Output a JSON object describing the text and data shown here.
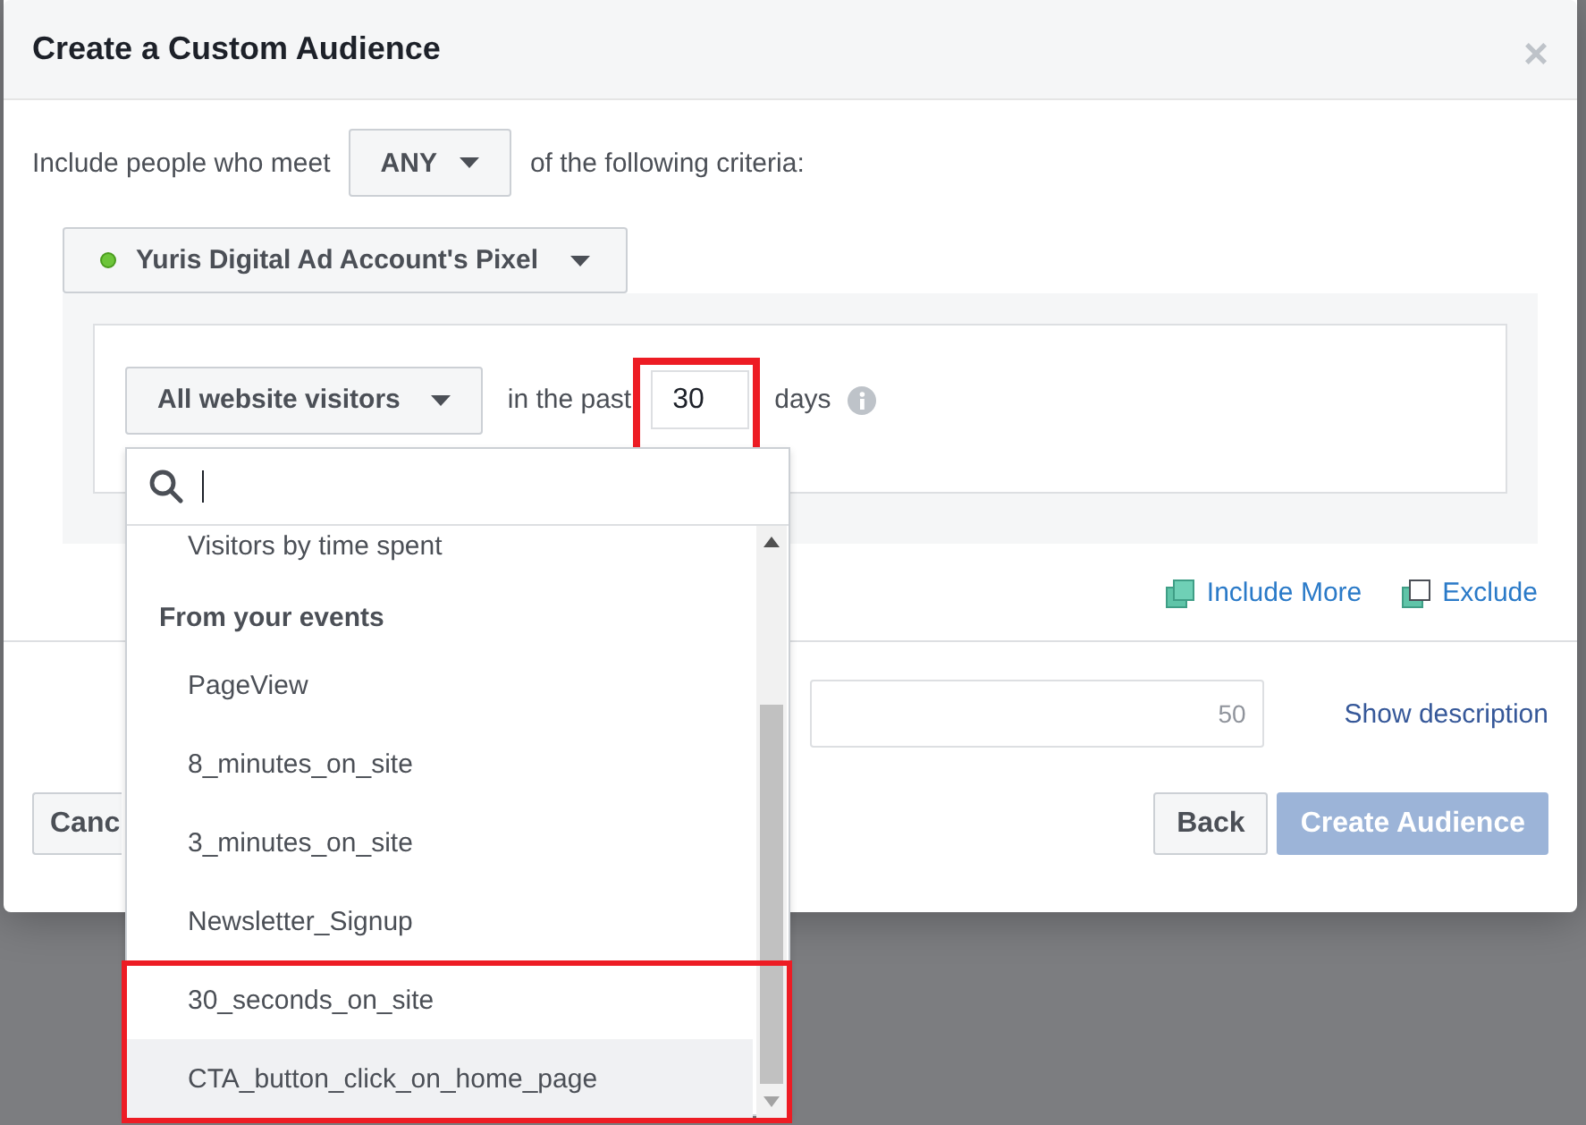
{
  "dialog": {
    "title": "Create a Custom Audience",
    "close_label": "×"
  },
  "criteria": {
    "prefix": "Include people who meet",
    "match": "ANY",
    "suffix": "of the following criteria:"
  },
  "pixel": {
    "name": "Yuris Digital Ad Account's Pixel",
    "active": true
  },
  "rule": {
    "audience": "All website visitors",
    "in_the_past": "in the past",
    "days": {
      "value": "30",
      "outlined": true
    },
    "days_label": "days"
  },
  "links": [
    {
      "label": "Include More",
      "kind": "include"
    },
    {
      "label": "Exclude",
      "kind": "exclude"
    }
  ],
  "name_field": {
    "counter": "50"
  },
  "show_description": "Show description",
  "buttons": [
    {
      "label": "Canc",
      "kind": "secondary",
      "disabled": false
    },
    {
      "label": "Back",
      "kind": "secondary",
      "disabled": false
    },
    {
      "label": "Create Audience",
      "kind": "primary",
      "disabled": true
    }
  ],
  "dropdown": {
    "items": [
      {
        "label": "Visitors by time spent",
        "kind": "option",
        "hovered": false,
        "outlined": false
      },
      {
        "label": "From your events",
        "kind": "header",
        "outlined": false
      },
      {
        "label": "PageView",
        "kind": "option",
        "hovered": false,
        "outlined": false
      },
      {
        "label": "8_minutes_on_site",
        "kind": "option",
        "hovered": false,
        "outlined": false
      },
      {
        "label": "3_minutes_on_site",
        "kind": "option",
        "hovered": false,
        "outlined": false
      },
      {
        "label": "Newsletter_Signup",
        "kind": "option",
        "hovered": false,
        "outlined": false
      },
      {
        "label": "30_seconds_on_site",
        "kind": "option",
        "hovered": false,
        "outlined": true
      },
      {
        "label": "CTA_button_click_on_home_page",
        "kind": "option",
        "hovered": true,
        "outlined": true
      }
    ]
  }
}
